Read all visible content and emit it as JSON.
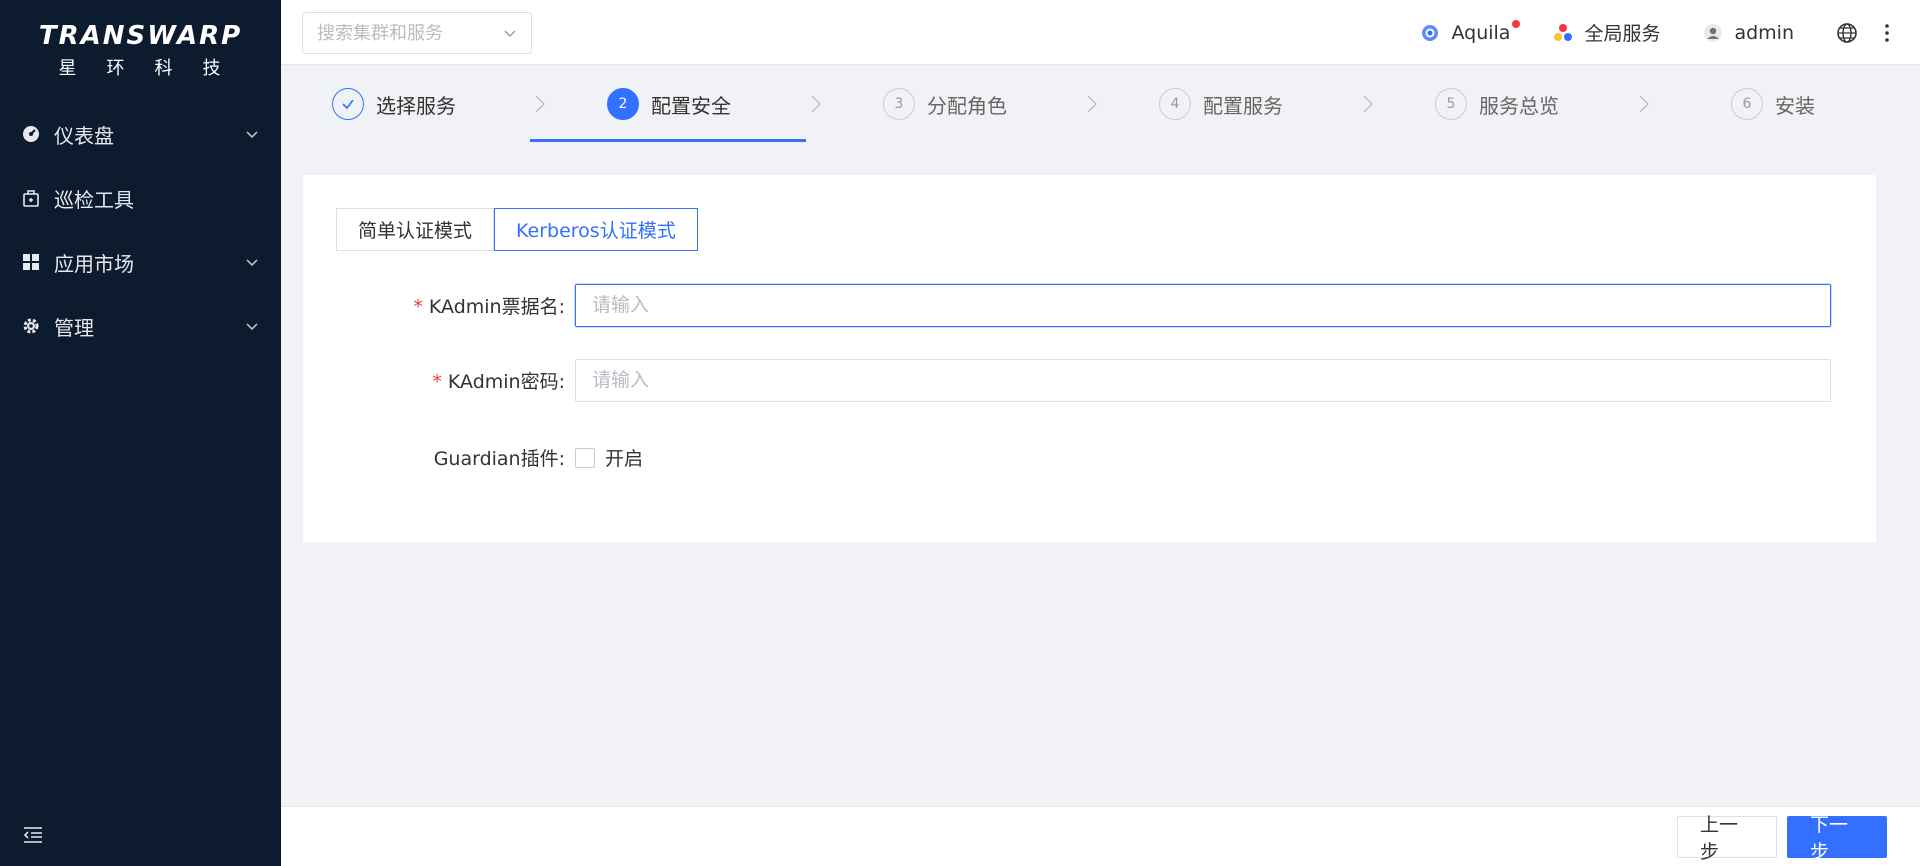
{
  "brand": {
    "name": "TRANSWARP",
    "subtitle": "星环科技"
  },
  "sidebar": {
    "items": [
      {
        "label": "仪表盘",
        "icon": "dashboard-icon",
        "expandable": true
      },
      {
        "label": "巡检工具",
        "icon": "inspection-icon",
        "expandable": false
      },
      {
        "label": "应用市场",
        "icon": "grid-icon",
        "expandable": true
      },
      {
        "label": "管理",
        "icon": "gear-icon",
        "expandable": true
      }
    ]
  },
  "header": {
    "search_placeholder": "搜索集群和服务",
    "aquila": "Aquila",
    "global_services": "全局服务",
    "user": "admin"
  },
  "steps": [
    {
      "num": "✓",
      "label": "选择服务",
      "state": "done"
    },
    {
      "num": "2",
      "label": "配置安全",
      "state": "active"
    },
    {
      "num": "3",
      "label": "分配角色",
      "state": "pending"
    },
    {
      "num": "4",
      "label": "配置服务",
      "state": "pending"
    },
    {
      "num": "5",
      "label": "服务总览",
      "state": "pending"
    },
    {
      "num": "6",
      "label": "安装",
      "state": "pending"
    }
  ],
  "form": {
    "modes": [
      "简单认证模式",
      "Kerberos认证模式"
    ],
    "active_mode": "Kerberos认证模式",
    "required_mark": "*",
    "kadmin_principal_label": "KAdmin票据名:",
    "kadmin_principal_placeholder": "请输入",
    "kadmin_password_label": "KAdmin密码:",
    "kadmin_password_placeholder": "请输入",
    "guardian_label": "Guardian插件:",
    "guardian_option": "开启",
    "guardian_checked": false
  },
  "footer": {
    "prev_label": "上一步",
    "next_label": "下一步"
  },
  "colors": {
    "primary": "#3370ff",
    "sidebar_bg": "#0d1b2e",
    "required": "#f5363b"
  }
}
